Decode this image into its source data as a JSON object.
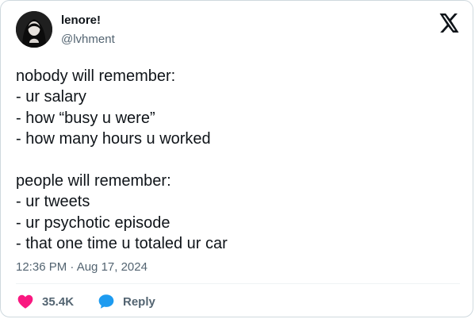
{
  "tweet": {
    "author": {
      "name": "lenore!",
      "handle": "@lvhment"
    },
    "text_lines": [
      "nobody will remember:",
      "- ur salary",
      "- how “busy u were”",
      "- how many hours u worked",
      "",
      "people will remember:",
      "- ur tweets",
      "- ur psychotic episode",
      "- that one time u totaled ur car"
    ],
    "timestamp": "12:36 PM · Aug 17, 2024",
    "actions": {
      "like_count": "35.4K",
      "reply_label": "Reply"
    }
  },
  "colors": {
    "text": "#0f1419",
    "secondary_text": "#536471",
    "like": "#f91880",
    "reply": "#1d9bf0",
    "border": "#cfd9de"
  },
  "icons": {
    "logo": "x-logo-icon",
    "like": "heart-icon",
    "reply": "speech-bubble-icon"
  }
}
